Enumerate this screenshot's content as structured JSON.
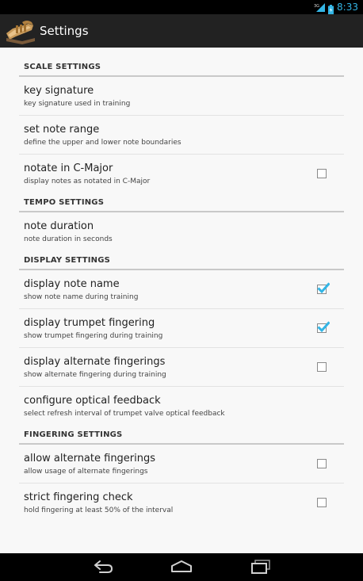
{
  "status_bar": {
    "network_label": "3G",
    "time": "8:33"
  },
  "action_bar": {
    "title": "Settings",
    "icon": "trumpet-app-icon"
  },
  "sections": [
    {
      "header": "SCALE SETTINGS",
      "items": [
        {
          "title": "key signature",
          "summary": "key signature used in training"
        },
        {
          "title": "set note range",
          "summary": "define the upper and lower note boundaries"
        },
        {
          "title": "notate in C-Major",
          "summary": "display notes as notated in C-Major",
          "checkbox": true,
          "checked": false
        }
      ]
    },
    {
      "header": "TEMPO SETTINGS",
      "items": [
        {
          "title": "note duration",
          "summary": "note duration in seconds"
        }
      ]
    },
    {
      "header": "DISPLAY SETTINGS",
      "items": [
        {
          "title": "display note name",
          "summary": "show note name during training",
          "checkbox": true,
          "checked": true
        },
        {
          "title": "display trumpet fingering",
          "summary": "show trumpet fingering during training",
          "checkbox": true,
          "checked": true
        },
        {
          "title": "display alternate fingerings",
          "summary": "show alternate fingering during training",
          "checkbox": true,
          "checked": false
        },
        {
          "title": "configure optical feedback",
          "summary": "select refresh interval of trumpet valve optical feedback"
        }
      ]
    },
    {
      "header": "FINGERING SETTINGS",
      "items": [
        {
          "title": "allow alternate fingerings",
          "summary": "allow usage of alternate fingerings",
          "checkbox": true,
          "checked": false
        },
        {
          "title": "strict fingering check",
          "summary": "hold fingering at least 50% of the interval",
          "checkbox": true,
          "checked": false
        }
      ]
    }
  ],
  "nav_bar": {
    "buttons": [
      "back-icon",
      "home-icon",
      "recent-apps-icon"
    ]
  },
  "colors": {
    "accent": "#33b5e5",
    "action_bar": "#222222",
    "background": "#f8f8f8"
  }
}
